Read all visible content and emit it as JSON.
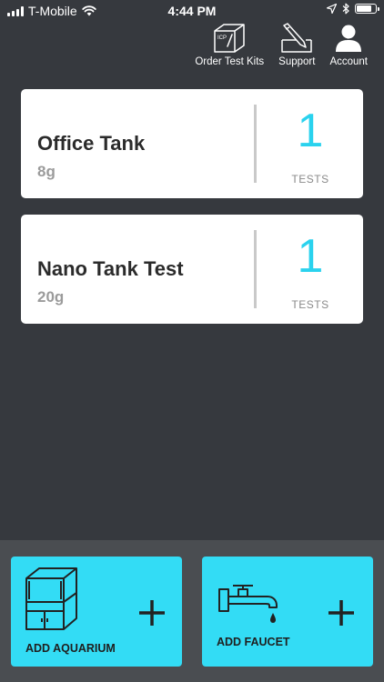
{
  "status_bar": {
    "carrier": "T-Mobile",
    "time": "4:44 PM"
  },
  "nav": {
    "order_test_kits": "Order Test Kits",
    "order_icon_text": "ICP",
    "support": "Support",
    "account": "Account"
  },
  "tanks": [
    {
      "name": "Office Tank",
      "volume": "8g",
      "count": "1",
      "count_label": "TESTS"
    },
    {
      "name": "Nano Tank Test",
      "volume": "20g",
      "count": "1",
      "count_label": "TESTS"
    }
  ],
  "actions": {
    "add_aquarium": "ADD AQUARIUM",
    "add_faucet": "ADD FAUCET"
  },
  "colors": {
    "background": "#36393e",
    "accent": "#2ad2ee",
    "action_button": "#33dcf5"
  }
}
